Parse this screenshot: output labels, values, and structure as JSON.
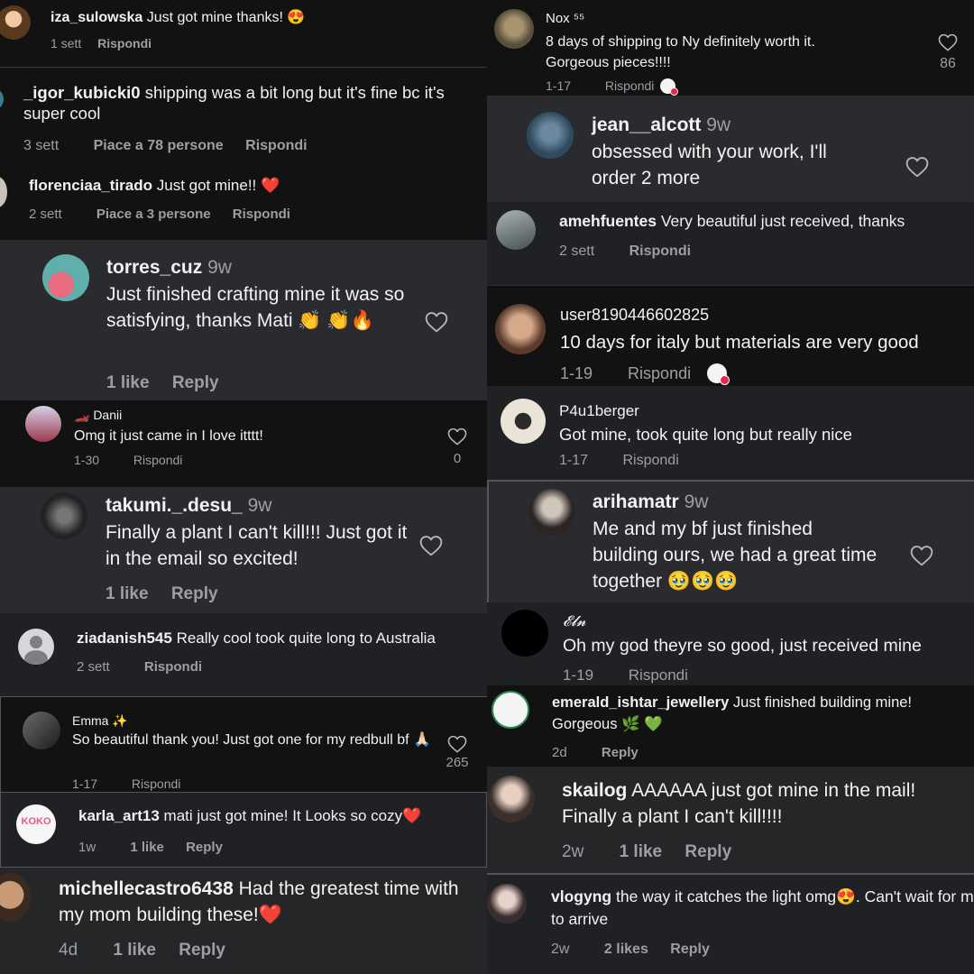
{
  "c1": {
    "user": "iza_sulowska",
    "text": "Just got mine thanks! 😍",
    "time": "1 sett",
    "reply": "Rispondi"
  },
  "c2": {
    "user": "_igor_kubicki0",
    "text": "shipping was a bit long but it's fine bc it's super cool",
    "time": "3 sett",
    "likes": "Piace a 78 persone",
    "reply": "Rispondi"
  },
  "c3": {
    "user": "florenciaa_tirado",
    "text": "Just got mine!! ❤️",
    "time": "2 sett",
    "likes": "Piace a 3 persone",
    "reply": "Rispondi"
  },
  "c4": {
    "user": "torres_cuz",
    "age": "9w",
    "text": "Just finished crafting mine it was so satisfying, thanks Mati 👏 👏🔥",
    "likes": "1 like",
    "reply": "Reply"
  },
  "c5": {
    "user": "🏎️ Danii",
    "text": "Omg it just came in I love itttt!",
    "time": "1-30",
    "reply": "Rispondi",
    "count": "0"
  },
  "c6": {
    "user": "takumi._.desu_",
    "age": "9w",
    "text": "Finally a plant I can't kill!!! Just got it in the email so excited!",
    "likes": "1 like",
    "reply": "Reply"
  },
  "c7": {
    "user": "ziadanish545",
    "text": "Really cool took quite long to Australia",
    "time": "2 sett",
    "reply": "Rispondi"
  },
  "c8": {
    "user": "Emma ✨",
    "text": "So beautiful thank you! Just got one for my redbull bf 🙏🏻",
    "time": "1-17",
    "reply": "Rispondi",
    "count": "265"
  },
  "c9": {
    "user": "karla_art13",
    "text": "mati just got mine! It Looks so cozy❤️",
    "time": "1w",
    "likes": "1 like",
    "reply": "Reply",
    "avatar_text": "KOKO"
  },
  "c10": {
    "user": "michellecastro6438",
    "text": "Had the greatest time with my mom building these!❤️",
    "time": "4d",
    "likes": "1 like",
    "reply": "Reply"
  },
  "c11": {
    "user": "Nox ⁵⁵",
    "text": "8 days of shipping to Ny definitely worth it. Gorgeous pieces!!!!",
    "time": "1-17",
    "reply": "Rispondi",
    "count": "86"
  },
  "c12": {
    "user": "jean__alcott",
    "age": "9w",
    "text": "obsessed with your work, I'll order 2 more"
  },
  "c13": {
    "user": "amehfuentes",
    "text": "Very beautiful just received, thanks",
    "time": "2 sett",
    "reply": "Rispondi"
  },
  "c14": {
    "user": "user8190446602825",
    "text": "10 days for italy but materials are very good",
    "time": "1-19",
    "reply": "Rispondi"
  },
  "c15": {
    "user": "P4u1berger",
    "text": "Got mine, took quite long but really nice",
    "time": "1-17",
    "reply": "Rispondi"
  },
  "c16": {
    "user": "arihamatr",
    "age": "9w",
    "text": "Me and my bf just finished building ours, we had a great time together 🥹🥹🥹"
  },
  "c17": {
    "user": "𝓔𝓵𝓷",
    "text": "Oh my god theyre so good, just received mine",
    "time": "1-19",
    "reply": "Rispondi"
  },
  "c18": {
    "user": "emerald_ishtar_jewellery",
    "text": "Just finished building mine! Gorgeous 🌿 💚",
    "time": "2d",
    "reply": "Reply"
  },
  "c19": {
    "user": "skailog",
    "text": "AAAAAA just got mine in the mail! Finally a plant I can't kill!!!!",
    "time": "2w",
    "likes": "1 like",
    "reply": "Reply"
  },
  "c20": {
    "user": "vlogyng",
    "text": "the way it catches the light omg😍. Can't wait for mine to arrive",
    "time": "2w",
    "likes": "2 likes",
    "reply": "Reply"
  },
  "colors": {
    "bg": "#18191c",
    "muted": "#9d9fa4",
    "heart_badge": "#e8254b"
  },
  "icons": [
    "heart-outline-icon",
    "creator-liked-avatar-badge",
    "default-avatar-icon"
  ]
}
